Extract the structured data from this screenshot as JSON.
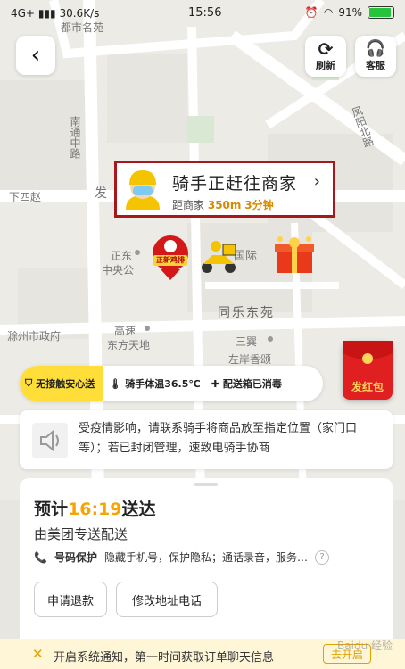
{
  "status_bar": {
    "network": "4G+",
    "speed": "30.6K/s",
    "time": "15:56",
    "battery": "91%",
    "battery_level": 0.91
  },
  "top_buttons": {
    "refresh_label": "刷新",
    "service_label": "客服"
  },
  "rider_card": {
    "title": "骑手正赶往商家",
    "distance_prefix": "距商家",
    "distance": "350m",
    "eta": "3分钟"
  },
  "map_labels": {
    "l1": "都市名苑",
    "l2": "南通中路",
    "l3": "下四赵",
    "l4": "正东",
    "l5": "中央公",
    "l6": "同乐东苑",
    "l7": "高速",
    "l8": "东方天地",
    "l9": "三巽",
    "l10": "左岸香颂",
    "l11": "滁州市政府",
    "l12": "凤阳北路",
    "l13": "国际",
    "l14": "发"
  },
  "merchant_badge": "正新鸡排",
  "red_packet": {
    "label": "发红包"
  },
  "safety_bar": {
    "tag": "无接触安心送",
    "item1": "骑手体温36.5℃",
    "item2": "配送箱已消毒"
  },
  "notice": {
    "text": "受疫情影响，请联系骑手将商品放至指定位置（家门口等）；若已封闭管理，速致电骑手协商"
  },
  "order_panel": {
    "eta_prefix": "预计",
    "eta_time": "16:19",
    "eta_suffix": "送达",
    "delivery_by": "由美团专送配送",
    "privacy_label": "号码保护",
    "privacy_desc": "隐藏手机号，保护隐私；通话录音，服务…",
    "refund_button": "申请退款",
    "address_button": "修改地址电话"
  },
  "bottom_bar": {
    "message": "开启系统通知，第一时间获取订单聊天信息",
    "open_button": "去开启"
  },
  "watermark": "Baidu 经验",
  "colors": {
    "accent": "#f5a500",
    "highlight_border": "#a8171c",
    "tag_yellow": "#ffde3a",
    "red_packet": "#e02020"
  }
}
